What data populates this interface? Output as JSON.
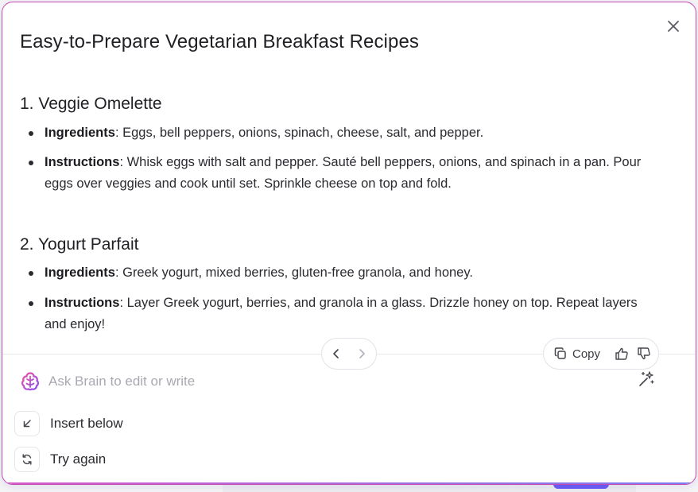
{
  "dialog": {
    "title": "Easy-to-Prepare Vegetarian Breakfast Recipes"
  },
  "recipes": [
    {
      "heading": "1. Veggie Omelette",
      "items": [
        {
          "label": "Ingredients",
          "text": ": Eggs, bell peppers, onions, spinach, cheese, salt, and pepper."
        },
        {
          "label": "Instructions",
          "text": ": Whisk eggs with salt and pepper. Sauté bell peppers, onions, and spinach in a pan. Pour eggs over veggies and cook until set. Sprinkle cheese on top and fold."
        }
      ]
    },
    {
      "heading": "2. Yogurt Parfait",
      "items": [
        {
          "label": "Ingredients",
          "text": ": Greek yogurt, mixed berries, gluten-free granola, and honey."
        },
        {
          "label": "Instructions",
          "text": ": Layer Greek yogurt, berries, and granola in a glass. Drizzle honey on top. Repeat layers and enjoy!"
        }
      ]
    }
  ],
  "toolbar": {
    "copy_label": "Copy"
  },
  "ask": {
    "placeholder": "Ask Brain to edit or write"
  },
  "options": {
    "insert_below": "Insert below",
    "try_again": "Try again"
  },
  "icons": {
    "close": "close-icon",
    "prev": "chevron-left-icon",
    "next": "chevron-right-icon",
    "copy": "copy-icon",
    "thumbs_up": "thumbs-up-icon",
    "thumbs_down": "thumbs-down-icon",
    "brain": "brain-logo-icon",
    "magic": "magic-wand-icon",
    "insert": "arrow-down-left-icon",
    "retry": "refresh-icon"
  },
  "colors": {
    "accent_pink": "#d85ac8",
    "accent_purple": "#7a7cf0",
    "text": "#1f1f24",
    "placeholder": "#a9a9b3"
  }
}
